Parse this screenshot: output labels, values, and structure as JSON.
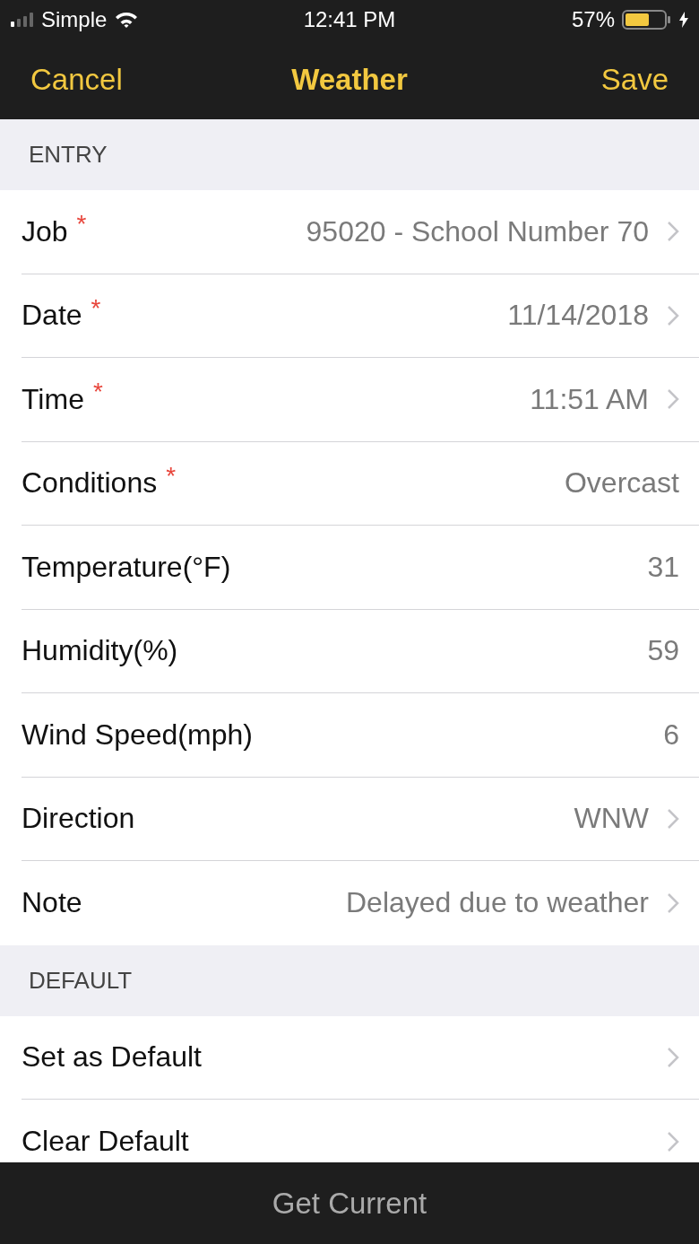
{
  "status_bar": {
    "carrier": "Simple",
    "time": "12:41 PM",
    "battery": "57%",
    "charging": true
  },
  "nav": {
    "cancel": "Cancel",
    "title": "Weather",
    "save": "Save"
  },
  "sections": [
    {
      "header": "ENTRY",
      "rows": [
        {
          "label": "Job",
          "required_mark": "*",
          "value": "95020 - School Number 70",
          "chevron": true
        },
        {
          "label": "Date",
          "required_mark": "*",
          "value": "11/14/2018",
          "chevron": true
        },
        {
          "label": "Time",
          "required_mark": "*",
          "value": "11:51 AM",
          "chevron": true
        },
        {
          "label": "Conditions",
          "required_mark": "*",
          "value": "Overcast",
          "chevron": false
        },
        {
          "label": "Temperature(°F)",
          "value": "31",
          "chevron": false
        },
        {
          "label": "Humidity(%)",
          "value": "59",
          "chevron": false
        },
        {
          "label": "Wind Speed(mph)",
          "value": "6",
          "chevron": false
        },
        {
          "label": "Direction",
          "value": "WNW",
          "chevron": true
        },
        {
          "label": "Note",
          "value": "Delayed due to weather",
          "chevron": true
        }
      ]
    },
    {
      "header": "DEFAULT",
      "rows": [
        {
          "label": "Set as Default",
          "chevron": true
        },
        {
          "label": "Clear Default",
          "chevron": true
        }
      ]
    }
  ],
  "bottom_button": "Get Current"
}
